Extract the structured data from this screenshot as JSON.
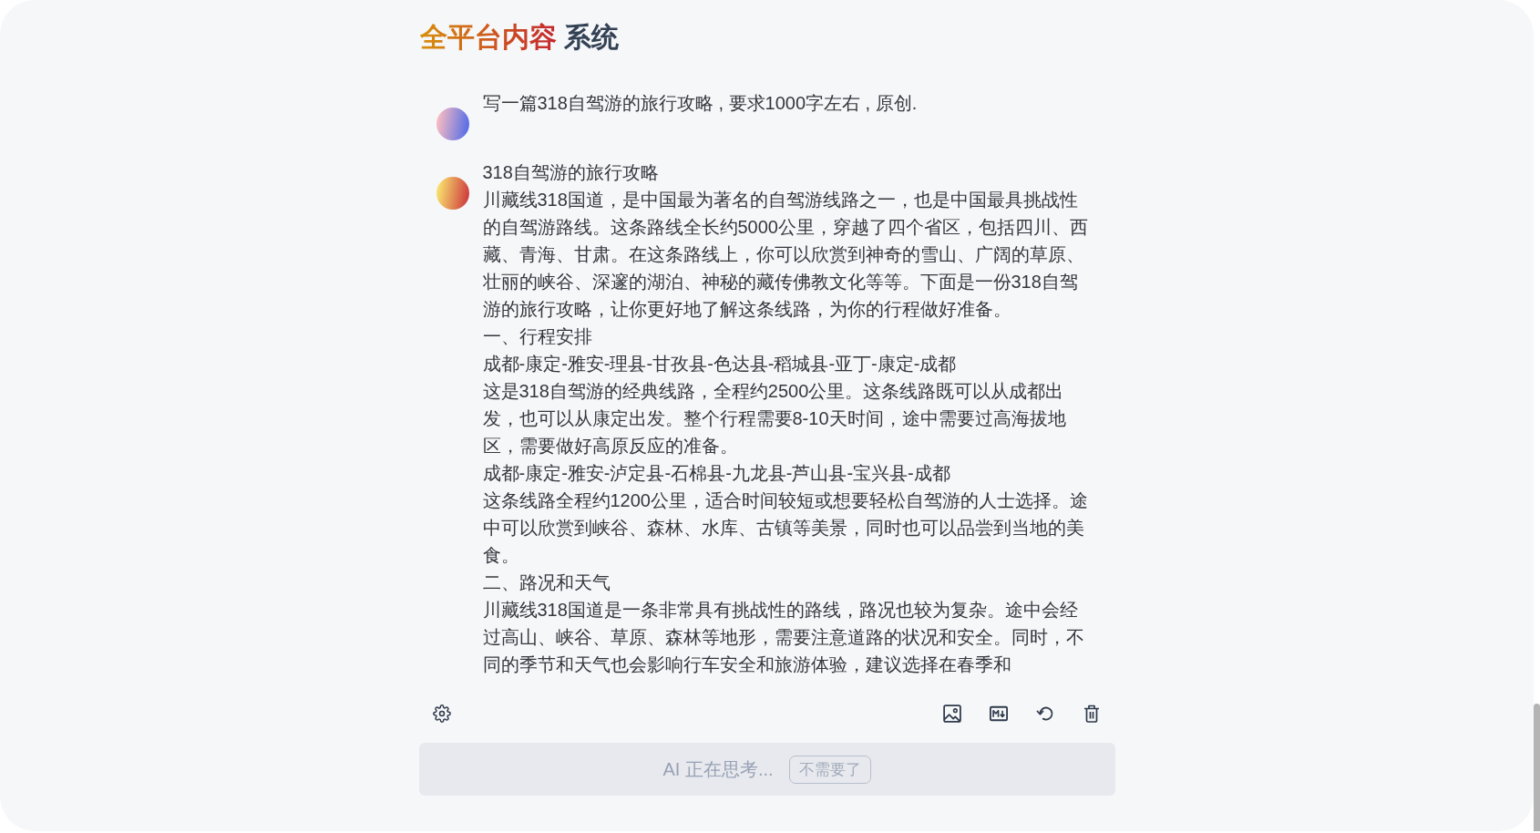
{
  "header": {
    "title_highlight": "全平台内容",
    "title_rest": "系统"
  },
  "messages": [
    {
      "kind": "user",
      "lines": [
        "写一篇318自驾游的旅行攻略 , 要求1000字左右 , 原创."
      ]
    },
    {
      "kind": "assistant",
      "lines": [
        "318自驾游的旅行攻略",
        "川藏线318国道，是中国最为著名的自驾游线路之一，也是中国最具挑战性的自驾游路线。这条路线全长约5000公里，穿越了四个省区，包括四川、西藏、青海、甘肃。在这条路线上，你可以欣赏到神奇的雪山、广阔的草原、壮丽的峡谷、深邃的湖泊、神秘的藏传佛教文化等等。下面是一份318自驾游的旅行攻略，让你更好地了解这条线路，为你的行程做好准备。",
        "一、行程安排",
        "成都-康定-雅安-理县-甘孜县-色达县-稻城县-亚丁-康定-成都",
        "这是318自驾游的经典线路，全程约2500公里。这条线路既可以从成都出发，也可以从康定出发。整个行程需要8-10天时间，途中需要过高海拔地区，需要做好高原反应的准备。",
        "成都-康定-雅安-泸定县-石棉县-九龙县-芦山县-宝兴县-成都",
        "这条线路全程约1200公里，适合时间较短或想要轻松自驾游的人士选择。途中可以欣赏到峡谷、森林、水库、古镇等美景，同时也可以品尝到当地的美食。",
        "二、路况和天气",
        "川藏线318国道是一条非常具有挑战性的路线，路况也较为复杂。途中会经过高山、峡谷、草原、森林等地形，需要注意道路的状况和安全。同时，不同的季节和天气也会影响行车安全和旅游体验，建议选择在春季和"
      ]
    }
  ],
  "status_bar": {
    "text": "AI 正在思考...",
    "button": "不需要了"
  }
}
